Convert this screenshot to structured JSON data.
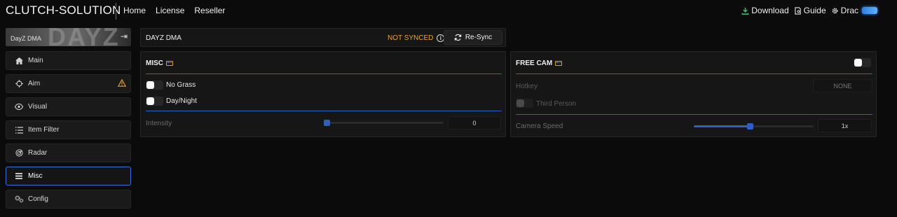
{
  "brand": "CLUTCH-SOLUTION",
  "nav": {
    "home": "Home",
    "license": "License",
    "reseller": "Reseller"
  },
  "nav_right": {
    "download": "Download",
    "guide": "Guide",
    "user": "Drac"
  },
  "sidebar": {
    "game_label": "DayZ DMA",
    "game_art_text": "DAYZ",
    "items": [
      {
        "label": "Main",
        "icon": "home-icon"
      },
      {
        "label": "Aim",
        "icon": "crosshair-icon",
        "warning": true
      },
      {
        "label": "Visual",
        "icon": "eye-icon"
      },
      {
        "label": "Item Filter",
        "icon": "list-icon"
      },
      {
        "label": "Radar",
        "icon": "radar-icon"
      },
      {
        "label": "Misc",
        "icon": "menu-icon",
        "active": true
      },
      {
        "label": "Config",
        "icon": "gears-icon"
      }
    ]
  },
  "header": {
    "title": "DAYZ DMA",
    "status": "NOT SYNCED",
    "resync_label": "Re-Sync"
  },
  "misc": {
    "title": "MISC",
    "no_grass": {
      "label": "No Grass",
      "enabled": false
    },
    "day_night": {
      "label": "Day/Night",
      "enabled": false
    },
    "intensity": {
      "label": "Intensity",
      "value": "0",
      "fraction": 0.0
    }
  },
  "freecam": {
    "title": "FREE CAM",
    "enabled": false,
    "hotkey": {
      "label": "Hotkey",
      "value": "NONE"
    },
    "third_person": {
      "label": "Third Person",
      "enabled": false
    },
    "camera_speed": {
      "label": "Camera Speed",
      "value": "1x",
      "fraction": 0.47
    }
  },
  "colors": {
    "accent": "#2f5fc4",
    "warning": "#f0a030",
    "download_icon": "#3ec46d"
  }
}
